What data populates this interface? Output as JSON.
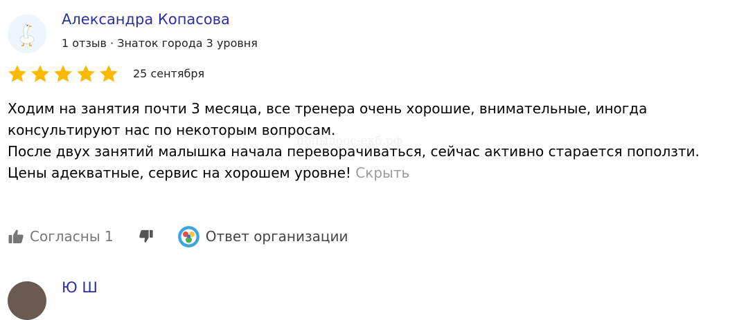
{
  "review": {
    "author": {
      "name": "Александра Копасова",
      "meta": "1 отзыв · Знаток города 3 уровня",
      "avatar_icon": "goose-icon"
    },
    "rating": 5,
    "rating_max": 5,
    "date": "25 сентября",
    "text_lines": [
      "Ходим на занятия почти 3 месяца, все тренера очень хорошие, внимательные, иногда консультируют нас по некоторым вопросам.",
      "После двух занятий малышка начала переворачиваться, сейчас активно старается поползти.",
      "Цены адекватные, сервис на хорошем уровне!"
    ],
    "hide_label": "Скрыть",
    "watermark": "попыдоос-екб.рф",
    "actions": {
      "agree_label": "Согласны 1",
      "org_reply_label": "Ответ организации"
    }
  },
  "next_review": {
    "name_partial": "Ю   Ш"
  },
  "colors": {
    "link": "#2a2fa6",
    "star": "#fcb900",
    "muted": "#999999",
    "action_gray": "#777777"
  }
}
